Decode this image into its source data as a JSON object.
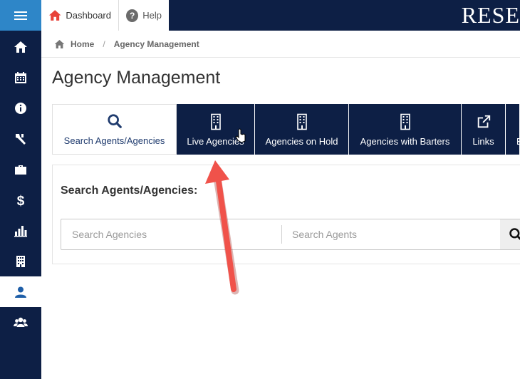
{
  "topbar": {
    "dashboard_label": "Dashboard",
    "help_label": "Help",
    "brand_text": "RESE"
  },
  "sidebar": {
    "items": [
      {
        "icon": "home-icon"
      },
      {
        "icon": "calendar-icon"
      },
      {
        "icon": "info-icon"
      },
      {
        "icon": "tools-icon"
      },
      {
        "icon": "briefcase-icon"
      },
      {
        "icon": "dollar-icon"
      },
      {
        "icon": "bar-chart-icon"
      },
      {
        "icon": "building-icon"
      },
      {
        "icon": "user-icon",
        "active": true
      },
      {
        "icon": "users-icon"
      }
    ]
  },
  "breadcrumb": {
    "home": "Home",
    "separator": "/",
    "current": "Agency Management"
  },
  "page": {
    "title": "Agency Management"
  },
  "actions": [
    {
      "label": "Search Agents/Agencies",
      "icon": "search-icon"
    },
    {
      "label": "Live Agencies",
      "icon": "building-icon"
    },
    {
      "label": "Agencies on Hold",
      "icon": "building-icon"
    },
    {
      "label": "Agencies with Barters",
      "icon": "building-icon"
    },
    {
      "label": "Links",
      "icon": "external-link-icon"
    },
    {
      "label": "B",
      "icon": "building-icon"
    }
  ],
  "search": {
    "title": "Search Agents/Agencies:",
    "agencies_placeholder": "Search Agencies",
    "agents_placeholder": "Search Agents"
  },
  "colors": {
    "navy": "#0d1f45",
    "accent_blue": "#2e86c8",
    "arrow": "#f0524a",
    "dashboard_icon": "#e8433a"
  }
}
